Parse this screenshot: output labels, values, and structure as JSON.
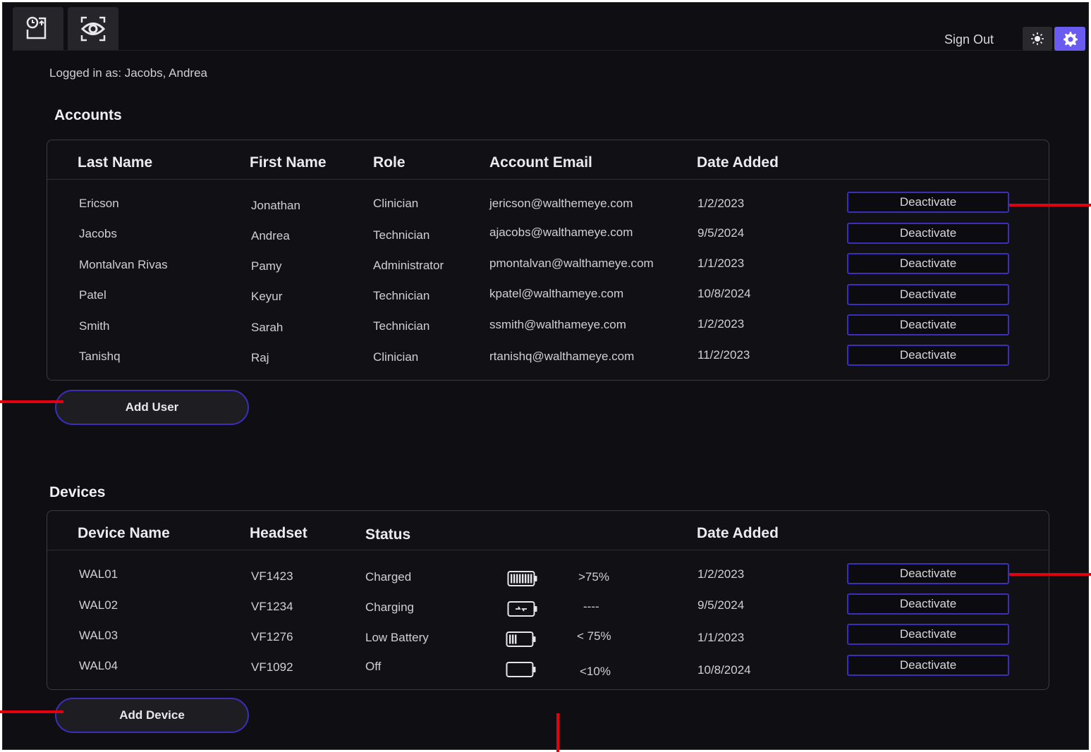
{
  "toolbar": {
    "tabs": [
      {
        "icon": "clock-export-icon"
      },
      {
        "icon": "eye-scan-icon"
      }
    ],
    "sign_out_label": "Sign Out",
    "theme_icon": "sun-icon",
    "settings_icon": "gear-icon",
    "accent_color": "#6a5cf0"
  },
  "session": {
    "logged_in_text": "Logged in as: Jacobs, Andrea"
  },
  "accounts": {
    "title": "Accounts",
    "columns": [
      "Last Name",
      "First Name",
      "Role",
      "Account Email",
      "Date Added"
    ],
    "rows": [
      {
        "last": "Ericson",
        "first": "Jonathan",
        "role": "Clinician",
        "email": "jericson@walthemeye.com",
        "date": "1/2/2023",
        "action": "Deactivate"
      },
      {
        "last": "Jacobs",
        "first": "Andrea",
        "role": "Technician",
        "email": "ajacobs@walthameye.com",
        "date": "9/5/2024",
        "action": "Deactivate"
      },
      {
        "last": "Montalvan Rivas",
        "first": "Pamy",
        "role": "Administrator",
        "email": "pmontalvan@walthameye.com",
        "date": "1/1/2023",
        "action": "Deactivate"
      },
      {
        "last": "Patel",
        "first": "Keyur",
        "role": "Technician",
        "email": "kpatel@walthameye.com",
        "date": "10/8/2024",
        "action": "Deactivate"
      },
      {
        "last": "Smith",
        "first": "Sarah",
        "role": "Technician",
        "email": "ssmith@walthameye.com",
        "date": "1/2/2023",
        "action": "Deactivate"
      },
      {
        "last": "Tanishq",
        "first": "Raj",
        "role": "Clinician",
        "email": "rtanishq@walthameye.com",
        "date": "11/2/2023",
        "action": "Deactivate"
      }
    ],
    "add_label": "Add User"
  },
  "devices": {
    "title": "Devices",
    "columns": [
      "Device Name",
      "Headset",
      "Status",
      "Date Added"
    ],
    "rows": [
      {
        "name": "WAL01",
        "headset": "VF1423",
        "status": "Charged",
        "battery_icon": "battery-full-icon",
        "level": ">75%",
        "date": "1/2/2023",
        "action": "Deactivate"
      },
      {
        "name": "WAL02",
        "headset": "VF1234",
        "status": "Charging",
        "battery_icon": "battery-charging-icon",
        "level": "----",
        "date": "9/5/2024",
        "action": "Deactivate"
      },
      {
        "name": "WAL03",
        "headset": "VF1276",
        "status": "Low Battery",
        "battery_icon": "battery-low-icon",
        "level": "< 75%",
        "date": "1/1/2023",
        "action": "Deactivate"
      },
      {
        "name": "WAL04",
        "headset": "VF1092",
        "status": "Off",
        "battery_icon": "battery-empty-icon",
        "level": "<10%",
        "date": "10/8/2024",
        "action": "Deactivate"
      }
    ],
    "add_label": "Add Device"
  },
  "annotation_color": "#e3000f"
}
